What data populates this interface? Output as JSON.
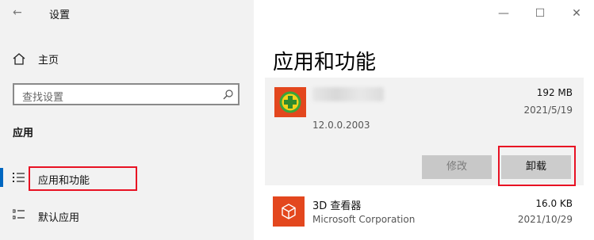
{
  "window": {
    "title": "设置",
    "back_icon": "←",
    "controls": {
      "minimize": "—",
      "maximize": "☐",
      "close": "✕"
    }
  },
  "sidebar": {
    "home_label": "主页",
    "search_placeholder": "查找设置",
    "section_title": "应用",
    "items": [
      {
        "label": "应用和功能",
        "selected": true
      },
      {
        "label": "默认应用",
        "selected": false
      }
    ]
  },
  "main": {
    "page_title": "应用和功能",
    "apps": [
      {
        "name": "",
        "size": "192 MB",
        "date": "2021/5/19",
        "version": "12.0.0.2003",
        "expanded": true,
        "buttons": {
          "modify": "修改",
          "uninstall": "卸载"
        }
      },
      {
        "name": "3D 查看器",
        "publisher": "Microsoft Corporation",
        "size": "16.0 KB",
        "date": "2021/10/29"
      }
    ]
  },
  "colors": {
    "sidebar_bg": "#f2f2f2",
    "accent": "#0067c0",
    "highlight_box": "#e81123",
    "app_icon_bg": "#e3471e"
  }
}
